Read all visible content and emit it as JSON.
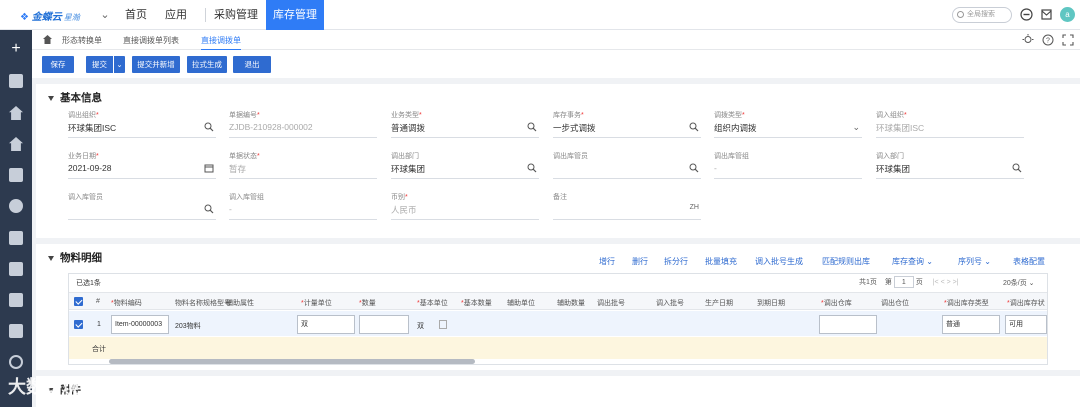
{
  "topbar": {
    "logo_text": "金蝶云",
    "logo_sub": "星瀚",
    "nav": [
      "首页",
      "应用",
      "采购管理",
      "库存管理"
    ],
    "search_placeholder": "全局搜索",
    "avatar_text": "a"
  },
  "tabs": [
    "形态转换单",
    "直接调拨单列表",
    "直接调拨单"
  ],
  "toolbar": {
    "save": "保存",
    "submit": "提交",
    "submit_new": "提交并新增",
    "push": "拉式生成",
    "exit": "退出"
  },
  "basic": {
    "title": "基本信息",
    "fields": [
      {
        "label": "调出组织",
        "req": true,
        "value": "环球集团ISC",
        "icon": "search-icon"
      },
      {
        "label": "单据编号",
        "req": true,
        "value": "ZJDB-210928-000002",
        "icon": "",
        "disabled": true
      },
      {
        "label": "业务类型",
        "req": true,
        "value": "普通调拨",
        "icon": "search-icon"
      },
      {
        "label": "库存事务",
        "req": true,
        "value": "一步式调拨",
        "icon": "search-icon"
      },
      {
        "label": "调拨类型",
        "req": true,
        "value": "组织内调拨",
        "icon": "chevron-down-icon"
      },
      {
        "label": "调入组织",
        "req": true,
        "value": "环球集团ISC",
        "icon": "",
        "disabled": true
      },
      {
        "label": "业务日期",
        "req": true,
        "value": "2021-09-28",
        "icon": "calendar-icon"
      },
      {
        "label": "单据状态",
        "req": true,
        "value": "暂存",
        "icon": "",
        "disabled": true
      },
      {
        "label": "调出部门",
        "req": false,
        "value": "环球集团",
        "icon": "search-icon"
      },
      {
        "label": "调出库管员",
        "req": false,
        "value": "",
        "icon": "search-icon"
      },
      {
        "label": "调出库管组",
        "req": false,
        "value": "-",
        "icon": "",
        "disabled": true
      },
      {
        "label": "调入部门",
        "req": false,
        "value": "环球集团",
        "icon": "search-icon"
      },
      {
        "label": "调入库管员",
        "req": false,
        "value": "",
        "icon": "search-icon"
      },
      {
        "label": "调入库管组",
        "req": false,
        "value": "-",
        "icon": "",
        "disabled": true
      },
      {
        "label": "币别",
        "req": true,
        "value": "人民币",
        "icon": "",
        "disabled": true
      },
      {
        "label": "备注",
        "req": false,
        "value": "",
        "icon": "ZH"
      }
    ]
  },
  "material": {
    "title": "物料明细",
    "actions": [
      "增行",
      "删行",
      "拆分行",
      "批量填充",
      "调入批号生成",
      "匹配规则出库",
      "库存查询",
      "序列号",
      "表格配置"
    ],
    "selected": "已选1条",
    "pager": {
      "total": "共1页",
      "page_prefix": "第",
      "page": "1",
      "page_suffix": "页",
      "size": "20条/页"
    },
    "columns": [
      "#",
      "物料编码",
      "物料名称",
      "规格型号",
      "辅助属性",
      "计量单位",
      "数量",
      "基本单位",
      "基本数量",
      "辅助单位",
      "辅助数量",
      "调出批号",
      "调入批号",
      "生产日期",
      "到期日期",
      "调出仓库",
      "调出仓位",
      "调出库存类型",
      "调出库存状"
    ],
    "required_cols": [
      "物料编码",
      "计量单位",
      "数量",
      "基本单位",
      "基本数量",
      "调出仓库",
      "调出库存类型",
      "调出库存状"
    ],
    "row": {
      "no": "1",
      "code": "Item-00000003",
      "name": "203物料",
      "unit": "双",
      "base_unit": "双",
      "stock_type": "普通",
      "stock_status": "可用"
    },
    "total_label": "合计"
  },
  "attachment": {
    "title": "附件"
  },
  "watermark": "大数跨境"
}
